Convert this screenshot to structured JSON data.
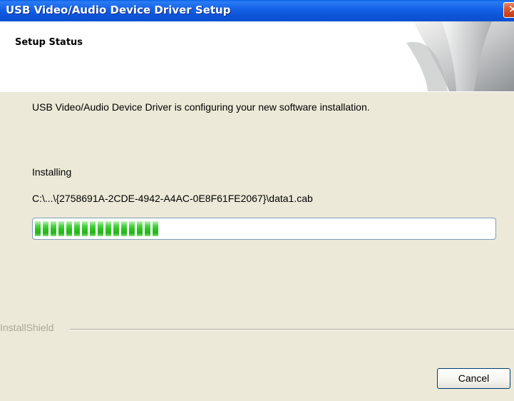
{
  "window": {
    "title": "USB Video/Audio Device Driver Setup",
    "close_icon": "close-icon"
  },
  "header": {
    "title": "Setup Status"
  },
  "main": {
    "description": "USB Video/Audio Device Driver is configuring your new software installation.",
    "status": "Installing",
    "file_path": "C:\\...\\{2758691A-2CDE-4942-A4AC-0E8F61FE2067}\\data1.cab",
    "progress_fraction": 0.28
  },
  "footer": {
    "brand": "InstallShield",
    "cancel_label": "Cancel"
  },
  "colors": {
    "titlebar": "#0b4fd0",
    "progress": "#2cc11f",
    "background": "#ece9d8"
  }
}
